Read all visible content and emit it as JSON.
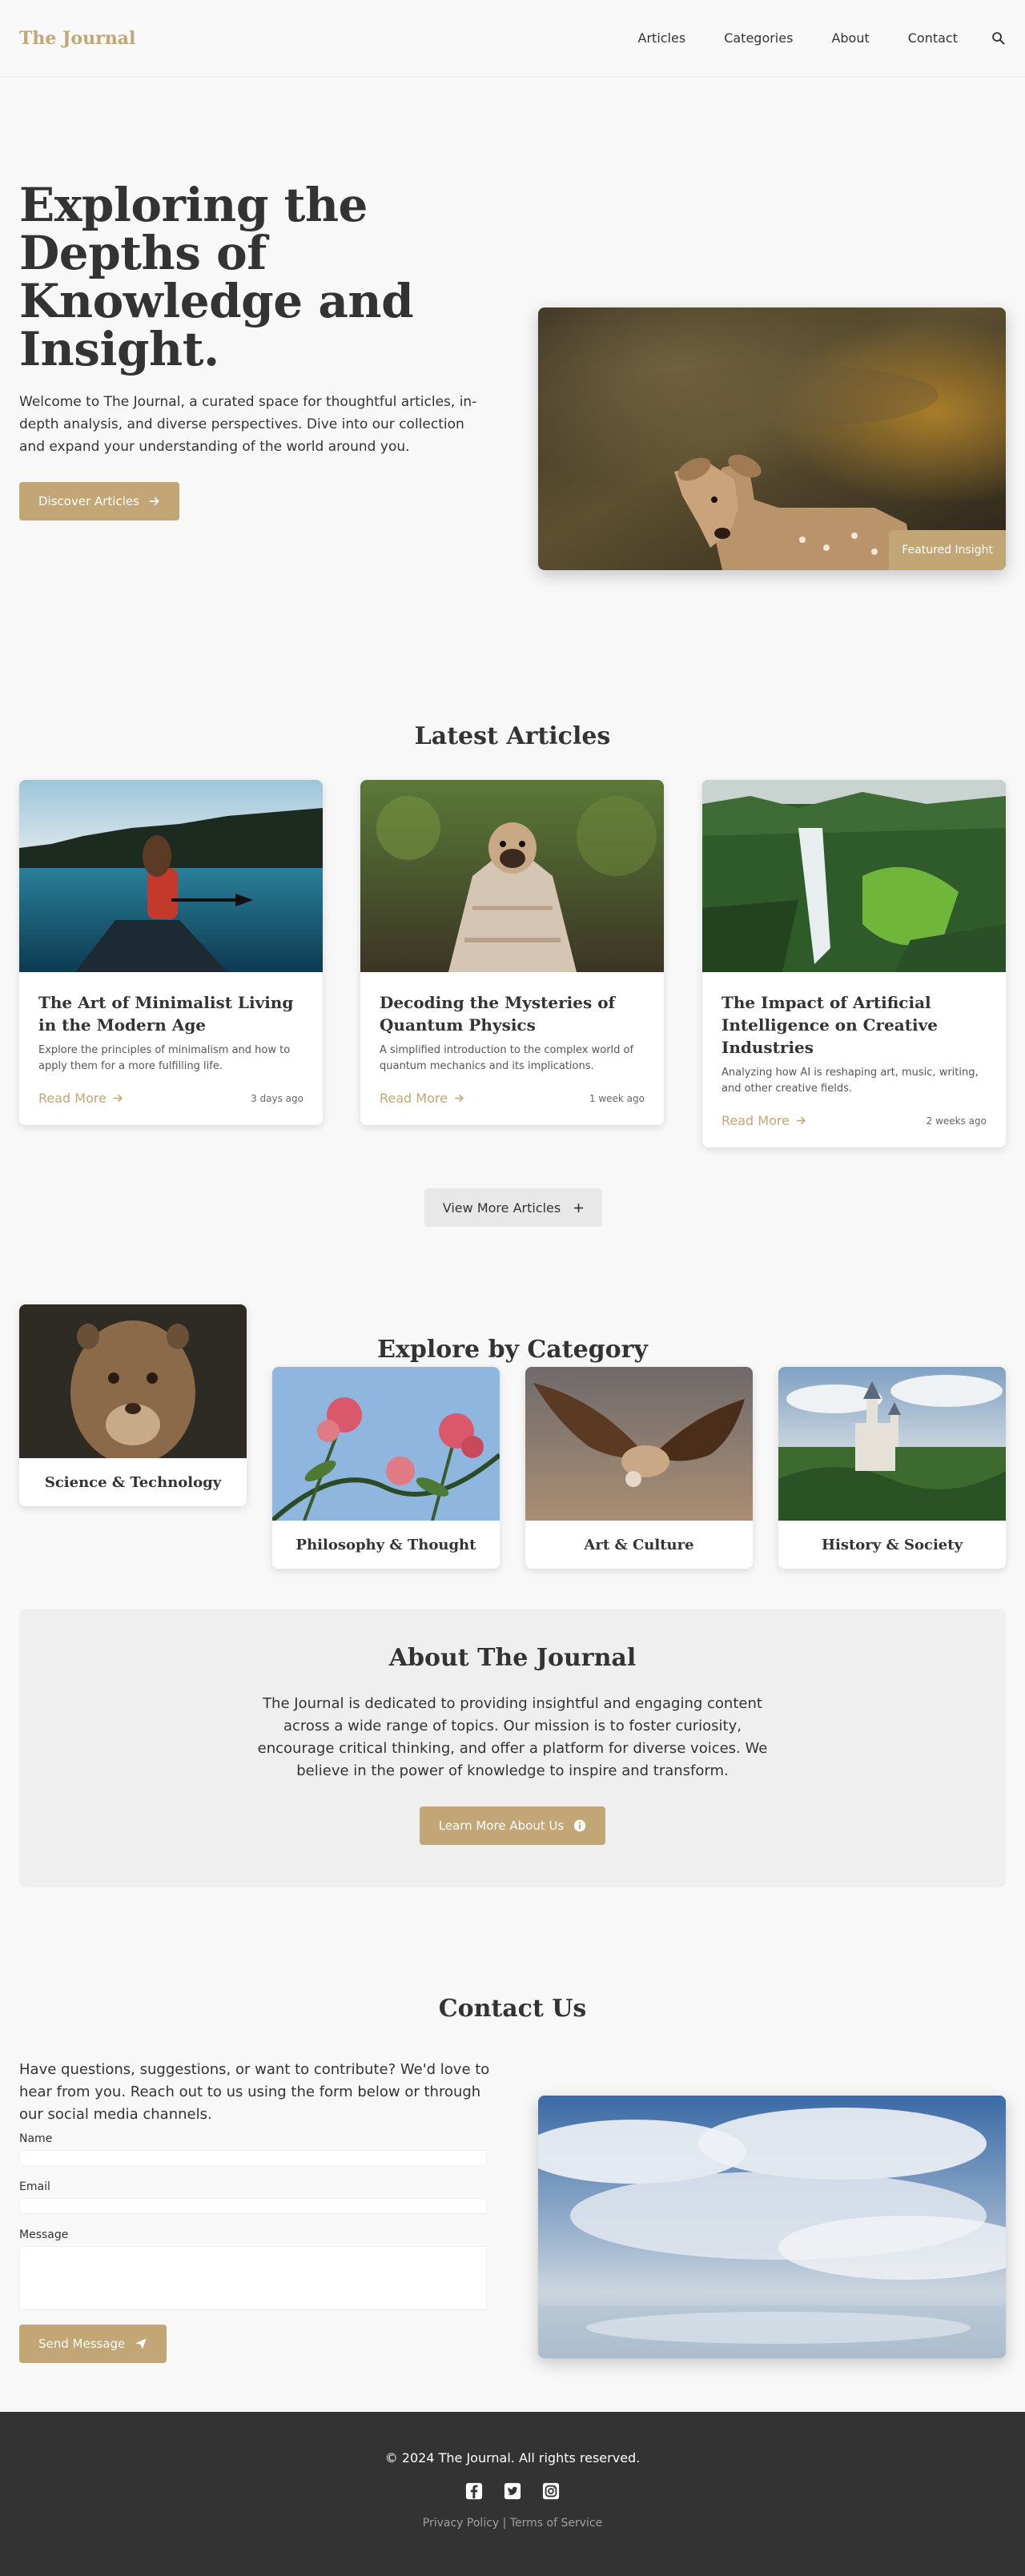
{
  "brand": {
    "accent": "#c2a675",
    "dark": "#333333"
  },
  "header": {
    "logo": "The Journal",
    "nav": [
      "Articles",
      "Categories",
      "About",
      "Contact"
    ],
    "search_icon": "search-icon"
  },
  "hero": {
    "title": "Exploring the Depths of Knowledge and Insight.",
    "intro": "Welcome to The Journal, a curated space for thoughtful articles, in-depth analysis, and diverse perspectives. Dive into our collection and expand your understanding of the world around you.",
    "cta": "Discover Articles",
    "badge": "Featured Insight"
  },
  "articles": {
    "title": "Latest Articles",
    "items": [
      {
        "title": "The Art of Minimalist Living in the Modern Age",
        "excerpt": "Explore the principles of minimalism and how to apply them for a more fulfilling life.",
        "link": "Read More",
        "date": "3 days ago"
      },
      {
        "title": "Decoding the Mysteries of Quantum Physics",
        "excerpt": "A simplified introduction to the complex world of quantum mechanics and its implications.",
        "link": "Read More",
        "date": "1 week ago"
      },
      {
        "title": "The Impact of Artificial Intelligence on Creative Industries",
        "excerpt": "Analyzing how AI is reshaping art, music, writing, and other creative fields.",
        "link": "Read More",
        "date": "2 weeks ago"
      }
    ],
    "view_more": "View More Articles"
  },
  "categories": {
    "title": "Explore by Category",
    "items": [
      "Science & Technology",
      "Philosophy & Thought",
      "Art & Culture",
      "History & Society"
    ]
  },
  "about": {
    "title": "About The Journal",
    "text": "The Journal is dedicated to providing insightful and engaging content across a wide range of topics. Our mission is to foster curiosity, encourage critical thinking, and offer a platform for diverse voices. We believe in the power of knowledge to inspire and transform.",
    "cta": "Learn More About Us"
  },
  "contact": {
    "title": "Contact Us",
    "intro": "Have questions, suggestions, or want to contribute? We'd love to hear from you. Reach out to us using the form below or through our social media channels.",
    "name_label": "Name",
    "email_label": "Email",
    "message_label": "Message",
    "submit": "Send Message"
  },
  "footer": {
    "copyright": "© 2024 The Journal. All rights reserved.",
    "privacy": "Privacy Policy",
    "separator": "|",
    "terms": "Terms of Service",
    "social_icons": [
      "facebook-icon",
      "twitter-icon",
      "instagram-icon"
    ]
  }
}
